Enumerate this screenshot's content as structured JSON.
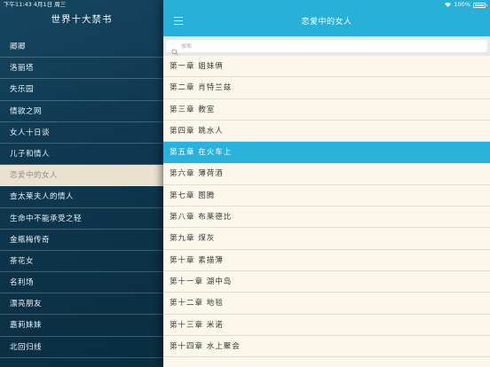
{
  "status": {
    "time_date": "下午11:43  4月1日 周三",
    "battery": "100%"
  },
  "sidebar": {
    "title": "世界十大禁书",
    "items": [
      {
        "label": "卿卿",
        "active": false
      },
      {
        "label": "洛丽塔",
        "active": false
      },
      {
        "label": "失乐园",
        "active": false
      },
      {
        "label": "情欲之网",
        "active": false
      },
      {
        "label": "女人十日谈",
        "active": false
      },
      {
        "label": "儿子和情人",
        "active": false
      },
      {
        "label": "恋爱中的女人",
        "active": true
      },
      {
        "label": "查太莱夫人的情人",
        "active": false
      },
      {
        "label": "生命中不能承受之轻",
        "active": false
      },
      {
        "label": "金瓶梅传奇",
        "active": false
      },
      {
        "label": "茶花女",
        "active": false
      },
      {
        "label": "名利场",
        "active": false
      },
      {
        "label": "漂亮朋友",
        "active": false
      },
      {
        "label": "嘉莉妹妹",
        "active": false
      },
      {
        "label": "北回归线",
        "active": false
      }
    ]
  },
  "navbar": {
    "title": "恋爱中的女人"
  },
  "search": {
    "placeholder": "搜索"
  },
  "chapters": [
    {
      "label": "第一章 姐妹俩",
      "active": false
    },
    {
      "label": "第二章 肖特兰兹",
      "active": false
    },
    {
      "label": "第三章 教室",
      "active": false
    },
    {
      "label": "第四章 跳水人",
      "active": false
    },
    {
      "label": "第五章 在火车上",
      "active": true
    },
    {
      "label": "第六章 薄荷酒",
      "active": false
    },
    {
      "label": "第七章 图腾",
      "active": false
    },
    {
      "label": "第八章 布莱德比",
      "active": false
    },
    {
      "label": "第九章 煤灰",
      "active": false
    },
    {
      "label": "第十章 素描薄",
      "active": false
    },
    {
      "label": "第十一章 湖中岛",
      "active": false
    },
    {
      "label": "第十二章 地毯",
      "active": false
    },
    {
      "label": "第十三章 米诺",
      "active": false
    },
    {
      "label": "第十四章 水上聚会",
      "active": false
    }
  ],
  "colors": {
    "accent": "#29b3dc",
    "sidebar_bg": "#0f3a52",
    "sidebar_active": "#e9e2cf",
    "list_bg": "#fbf7ea"
  }
}
